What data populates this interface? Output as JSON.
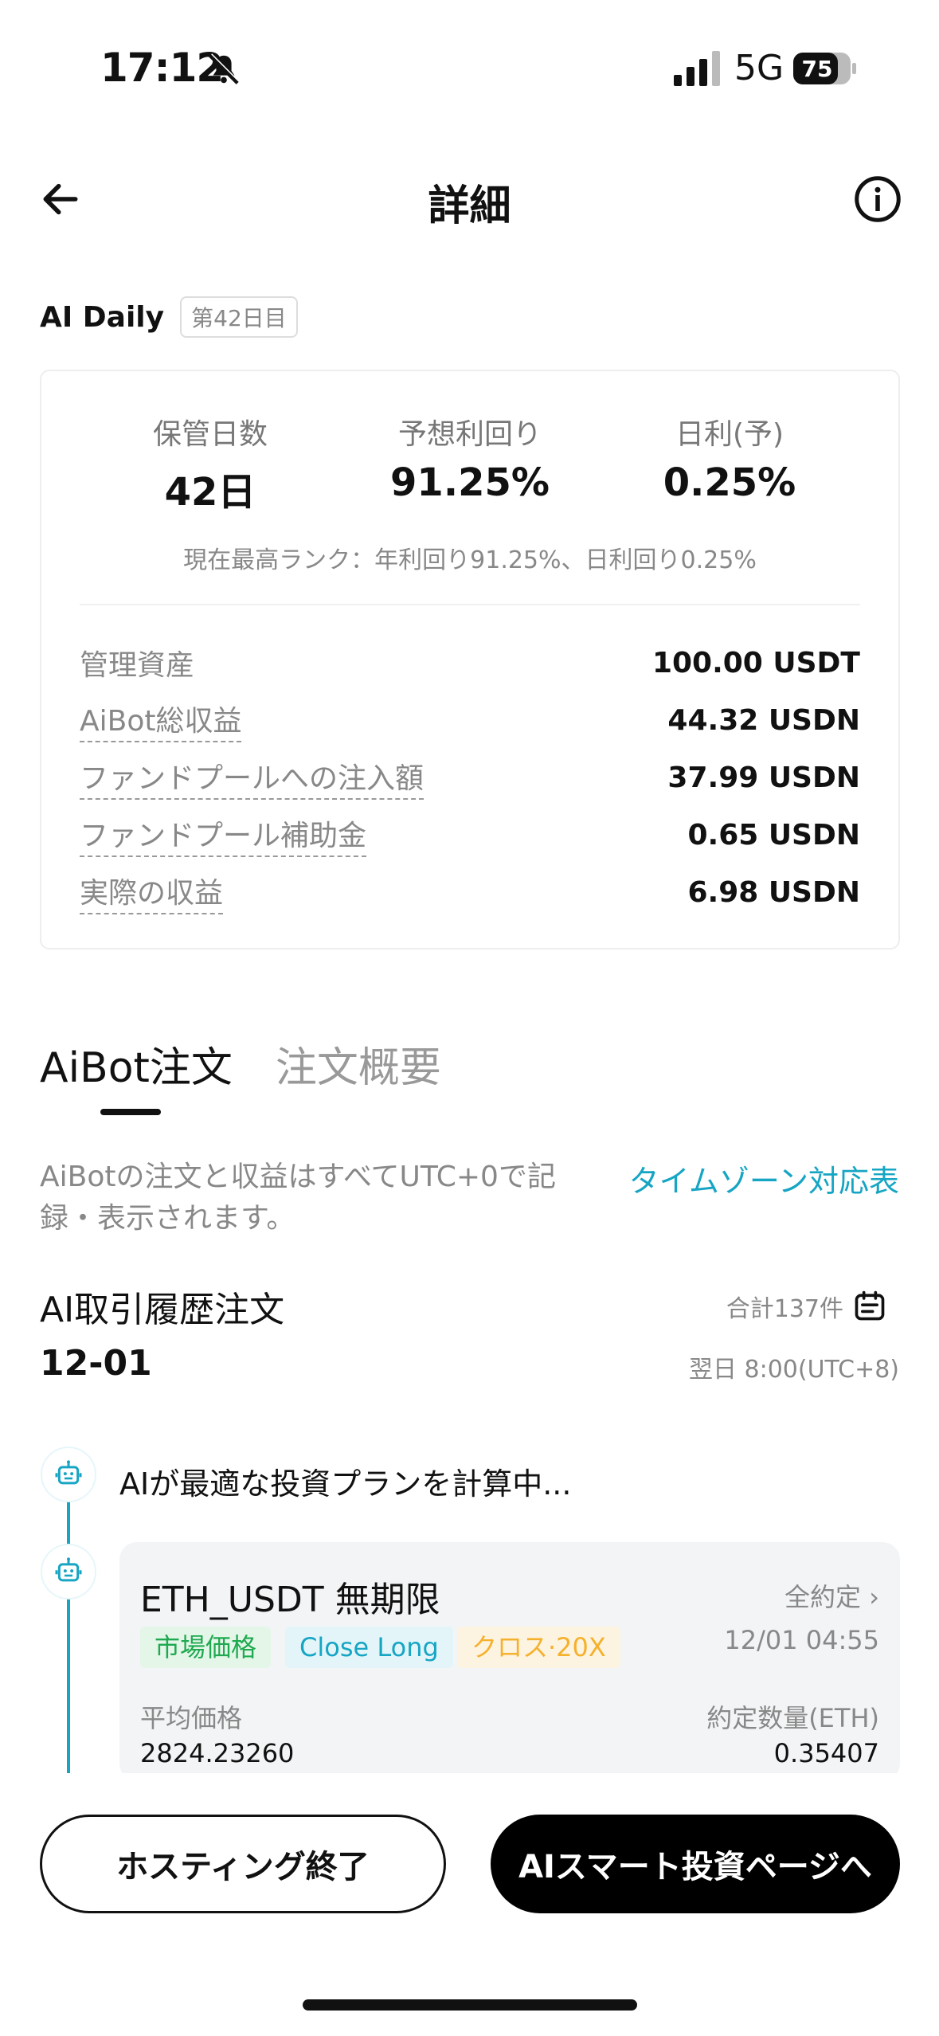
{
  "status_bar": {
    "time": "17:12",
    "network": "5G",
    "battery": "75"
  },
  "header": {
    "title": "詳細"
  },
  "ai_daily": {
    "label": "AI Daily",
    "day_badge": "第42日目"
  },
  "stats": {
    "items": [
      {
        "label": "保管日数",
        "value": "42日"
      },
      {
        "label": "予想利回り",
        "value": "91.25%"
      },
      {
        "label": "日利(予)",
        "value": "0.25%"
      }
    ],
    "rank_note": "現在最高ランク：年利回り91.25%、日利回り0.25%"
  },
  "summary_rows": [
    {
      "label": "管理資産",
      "value": "100.00 USDT"
    },
    {
      "label": "AiBot総収益",
      "value": "44.32 USDN"
    },
    {
      "label": "ファンドプールへの注入額",
      "value": "37.99 USDN"
    },
    {
      "label": "ファンドプール補助金",
      "value": "0.65 USDN"
    },
    {
      "label": "実際の収益",
      "value": "6.98 USDN"
    }
  ],
  "tabs": [
    "AiBot注文",
    "注文概要"
  ],
  "notice": "AiBotの注文と収益はすべてUTC+0で記録・表示されます。",
  "timezone_link": "タイムゾーン対応表",
  "history": {
    "title": "AI取引履歴注文",
    "count": "合計137件",
    "date": "12-01",
    "next_time": "翌日 8:00(UTC+8)",
    "calculating": "AIが最適な投資プランを計算中..."
  },
  "order": {
    "symbol": "ETH_USDT 無期限",
    "status": "全約定",
    "time": "12/01 04:55",
    "tags": [
      "市場価格",
      "Close Long",
      "クロス·20X"
    ],
    "avg_price_label": "平均価格",
    "avg_price": "2824.23260",
    "qty_label": "約定数量(ETH)",
    "qty": "0.35407"
  },
  "buttons": {
    "end_hosting": "ホスティング終了",
    "go_ai": "AIスマート投資ページへ"
  },
  "colors": {
    "accent": "#17a5c4",
    "green": "#1fa950",
    "orange": "#f5b12c"
  }
}
